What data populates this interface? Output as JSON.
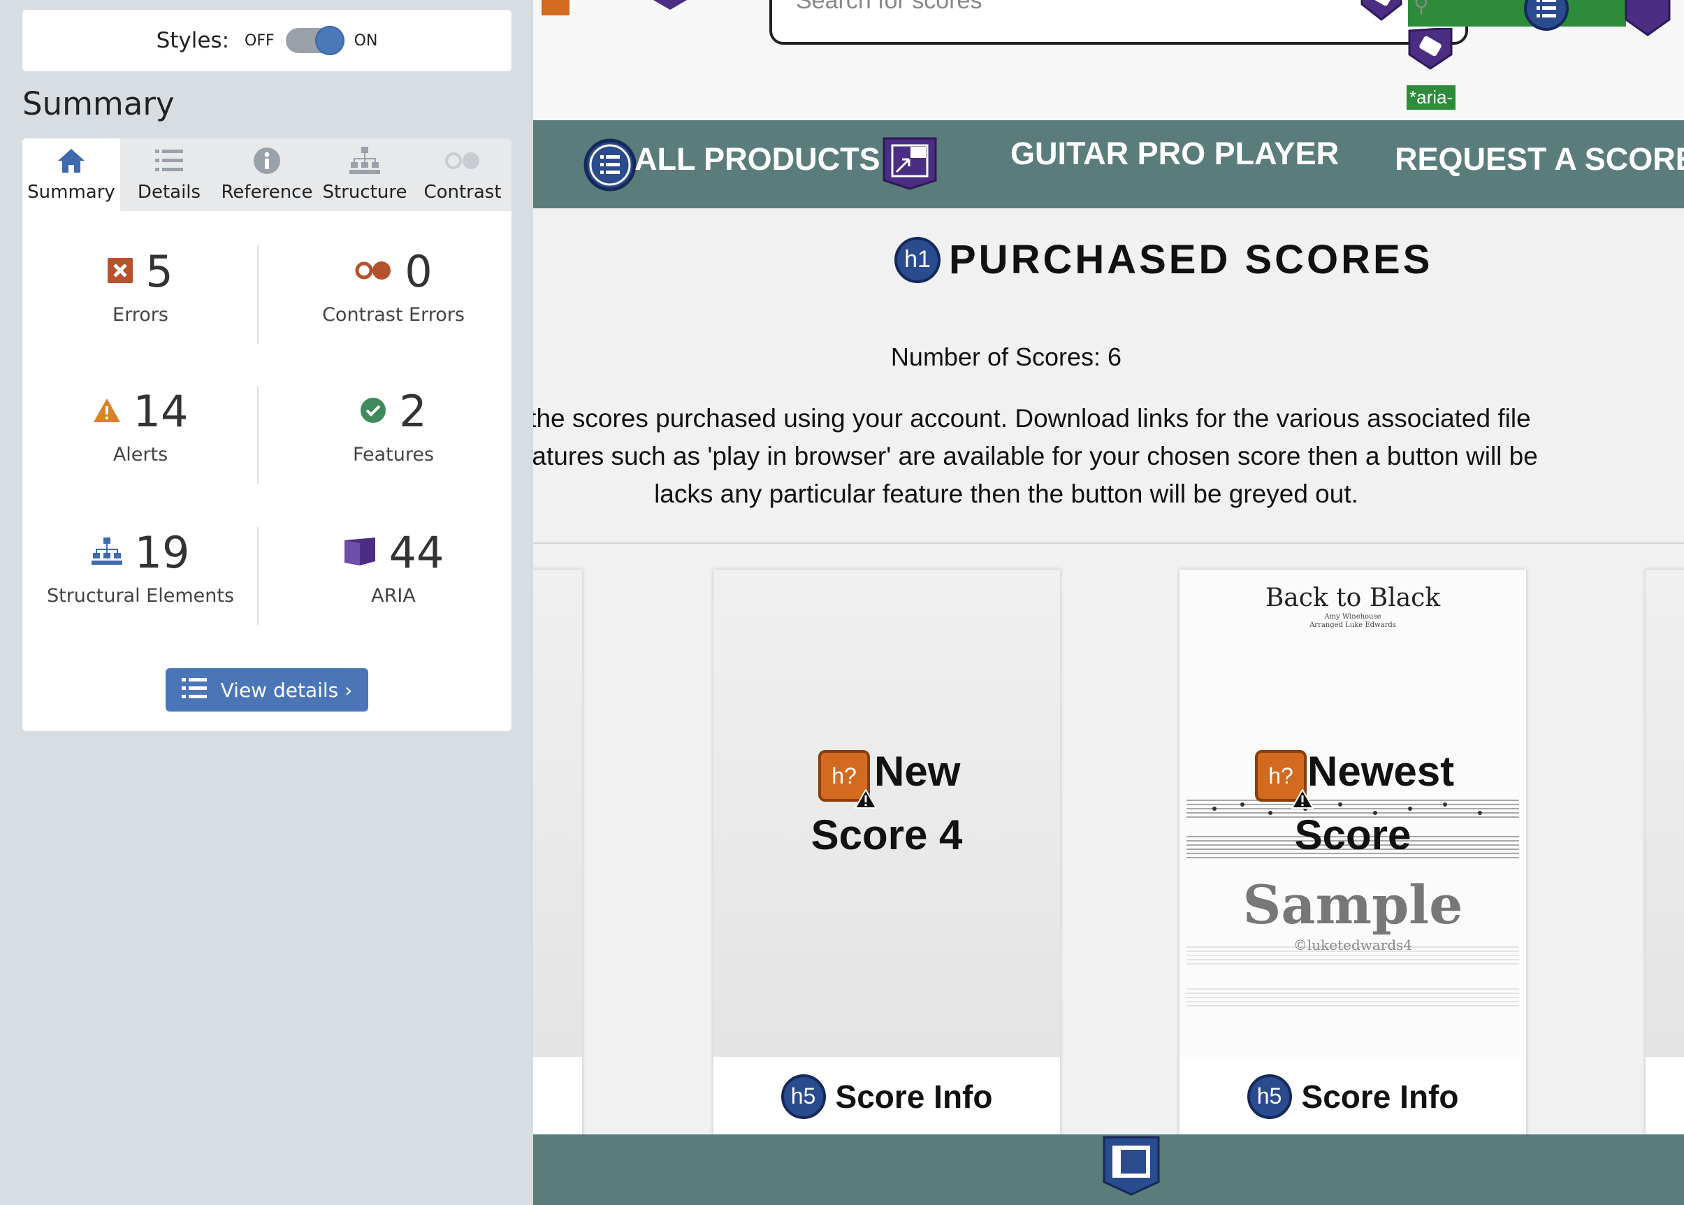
{
  "sidebar": {
    "styles_label": "Styles:",
    "toggle_off": "OFF",
    "toggle_on": "ON",
    "heading": "Summary",
    "tabs": [
      {
        "label": "Summary",
        "icon": "home-icon"
      },
      {
        "label": "Details",
        "icon": "list-icon"
      },
      {
        "label": "Reference",
        "icon": "info-icon"
      },
      {
        "label": "Structure",
        "icon": "structure-icon"
      },
      {
        "label": "Contrast",
        "icon": "contrast-icon"
      }
    ],
    "stats": {
      "errors": {
        "value": "5",
        "label": "Errors"
      },
      "contrast": {
        "value": "0",
        "label": "Contrast Errors"
      },
      "alerts": {
        "value": "14",
        "label": "Alerts"
      },
      "features": {
        "value": "2",
        "label": "Features"
      },
      "structural": {
        "value": "19",
        "label": "Structural Elements"
      },
      "aria": {
        "value": "44",
        "label": "ARIA"
      }
    },
    "view_details": "View details ›"
  },
  "site": {
    "search_placeholder": "Search for scores",
    "aria_tag": "*aria-",
    "nav": {
      "all_products": "ALL PRODUCTS",
      "guitar_pro_player": "GUITAR PRO PLAYER",
      "request_score": "REQUEST A SCORE"
    },
    "page_title": "PURCHASED SCORES",
    "h1_badge": "h1",
    "num_scores": "Number of Scores: 6",
    "intro_lines": [
      "ll of the scores purchased using your account. Download links for the various associated file",
      ". If features such as 'play in browser' are available for your chosen score then a button will be",
      "lacks any particular feature then the button will be greyed out."
    ],
    "cards": [
      {
        "title_line1": "New",
        "title_line2": "Score 4",
        "badge": "h?",
        "footer_badge": "h5",
        "footer": "Score Info"
      },
      {
        "title_line1": "Newest",
        "title_line2": "Score",
        "badge": "h?",
        "footer_badge": "h5",
        "footer": "Score Info",
        "sheet_title": "Back to Black",
        "sheet_composer": "Amy Winehouse",
        "sheet_arranger": "Arranged Luke Edwards",
        "watermark": "Sample",
        "watermark_credit": "©luketedwards4"
      }
    ]
  },
  "colors": {
    "nav_bg": "#5a7d7c",
    "wave_blue": "#4a76b8",
    "error": "#b5522b",
    "alert": "#d9822b",
    "feature": "#3f8a5a",
    "aria": "#4b2e83"
  }
}
